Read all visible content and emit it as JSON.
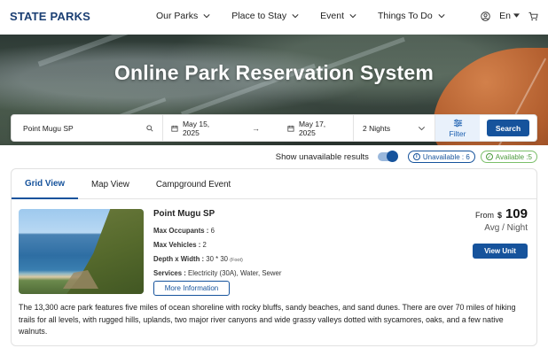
{
  "nav": {
    "brand": "STATE PARKS",
    "links": [
      "Our Parks",
      "Place to Stay",
      "Event",
      "Things To Do"
    ],
    "language": "En"
  },
  "hero": {
    "title": "Online Park Reservation System"
  },
  "search": {
    "park": "Point Mugu SP",
    "arrival": "May 15, 2025",
    "departure": "May 17, 2025",
    "nights": "2 Nights",
    "filter_label": "Filter",
    "search_label": "Search"
  },
  "options": {
    "show_unavailable_label": "Show unavailable results",
    "show_unavailable_on": true,
    "unavailable_badge": "Unavailable : 6",
    "available_badge": "Available :5"
  },
  "tabs": [
    "Grid View",
    "Map View",
    "Campground Event"
  ],
  "active_tab": "Grid View",
  "result": {
    "name": "Point Mugu SP",
    "max_occupants_label": "Max Occupants :",
    "max_occupants": "6",
    "max_vehicles_label": "Max Vehicles :",
    "max_vehicles": "2",
    "depth_width_label": "Depth x Width :",
    "depth_width": "30 * 30",
    "depth_width_unit": "(Foot)",
    "services_label": "Services :",
    "services": "Electricity (30A), Water, Sewer",
    "more_info_label": "More Information",
    "price_from": "From",
    "price_currency": "$",
    "price": "109",
    "price_unit": "Avg / Night",
    "view_unit_label": "View Unit",
    "description": "The 13,300 acre park features five miles of ocean shoreline with rocky bluffs, sandy beaches, and sand dunes. There are over 70 miles of hiking trails for all levels, with rugged hills, uplands, two major river canyons and wide grassy valleys dotted with sycamores, oaks, and a few native walnuts."
  },
  "colors": {
    "brand": "#1b3f73",
    "primary": "#16539c",
    "available": "#4c9a3c"
  }
}
